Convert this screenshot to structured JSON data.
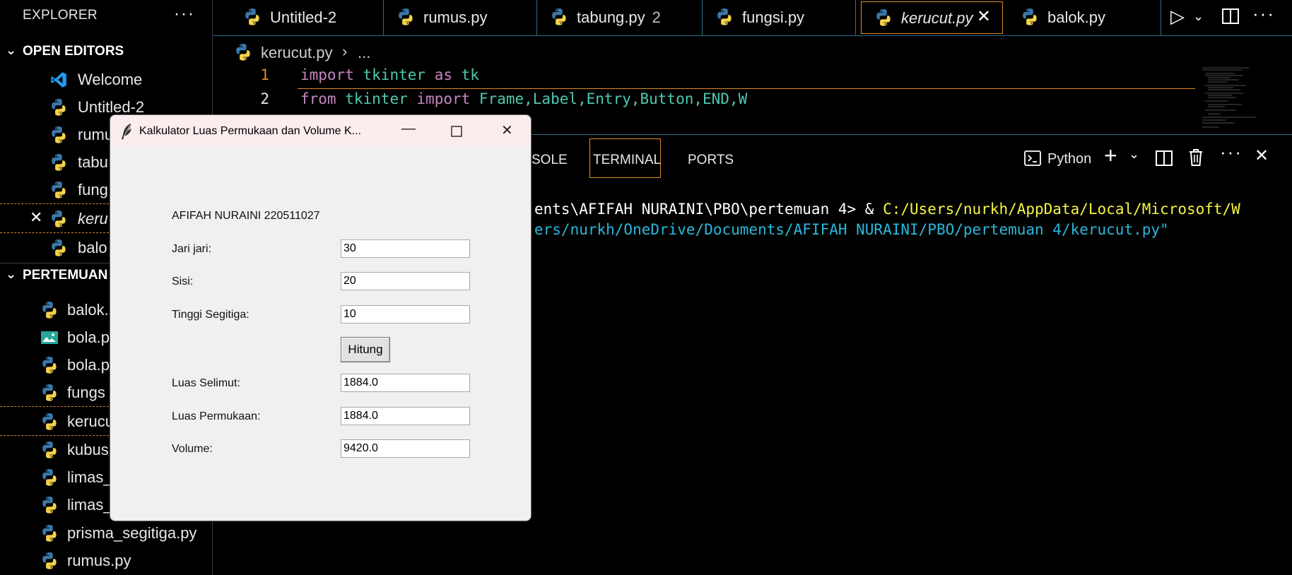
{
  "explorer": {
    "title": "EXPLORER",
    "more": "···",
    "open_editors_title": "OPEN EDITORS",
    "open_editors": [
      "Welcome",
      "Untitled-2",
      "rumu",
      "tabu",
      "fung",
      "keru",
      "balo"
    ],
    "folder_title": "PERTEMUAN",
    "files": [
      "balok.",
      "bola.p",
      "bola.p",
      "fungs",
      "kerucu",
      "kubus",
      "limas_",
      "limas_",
      "prisma_segitiga.py",
      "rumus.py"
    ]
  },
  "tabs": [
    {
      "label": "Untitled-2",
      "badge": ""
    },
    {
      "label": "rumus.py",
      "badge": ""
    },
    {
      "label": "tabung.py",
      "badge": "2"
    },
    {
      "label": "fungsi.py",
      "badge": ""
    },
    {
      "label": "kerucut.py",
      "badge": ""
    },
    {
      "label": "balok.py",
      "badge": ""
    }
  ],
  "breadcrumb": {
    "file": "kerucut.py",
    "sep": "›",
    "more": "..."
  },
  "editor": {
    "lines": [
      {
        "no": "1",
        "kw": "import",
        "rest1": " ",
        "mod": "tkinter",
        "rest2": " ",
        "kw2": "as",
        "rest3": " ",
        "alias": "tk"
      },
      {
        "no": "2",
        "kw": "from",
        "mod": "tkinter",
        "kw2": "import",
        "names": "Frame,Label,Entry,Button,END,W"
      }
    ]
  },
  "panel": {
    "tabs": [
      "SOLE",
      "TERMINAL",
      "PORTS"
    ],
    "shell_label": "Python",
    "terminal": {
      "line1_white": "ents\\AFIFAH NURAINI\\PBO\\pertemuan 4> & ",
      "line1_yellow": "C:/Users/nurkh/AppData/Local/Microsoft/W",
      "line2_cyan": "ers/nurkh/OneDrive/Documents/AFIFAH NURAINI/PBO/pertemuan 4/kerucut.py\""
    }
  },
  "tkapp": {
    "title": "Kalkulator Luas Permukaan dan Volume K...",
    "header": "AFIFAH NURAINI 220511027",
    "jari_label": "Jari jari:",
    "jari_value": "30",
    "sisi_label": "Sisi:",
    "sisi_value": "20",
    "tinggi_label": "Tinggi Segitiga:",
    "tinggi_value": "10",
    "button": "Hitung",
    "selimut_label": "Luas Selimut:",
    "selimut_value": "1884.0",
    "permukaan_label": "Luas Permukaan:",
    "permukaan_value": "1884.0",
    "volume_label": "Volume:",
    "volume_value": "9420.0"
  },
  "colors": {
    "accent_border": "#e08a2a",
    "python_blue": "#3b77a8",
    "python_yellow": "#f5d24a"
  }
}
